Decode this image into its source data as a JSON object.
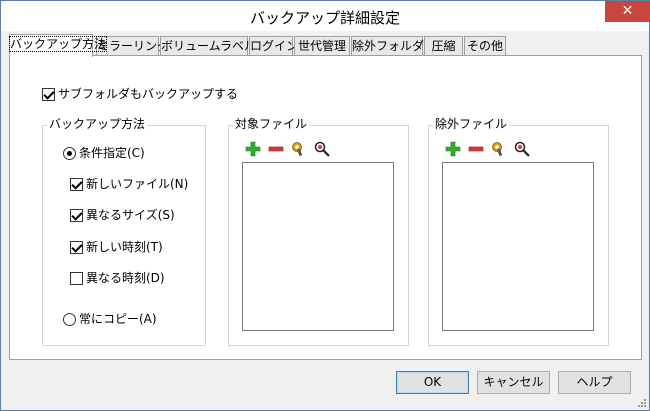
{
  "window": {
    "title": "バックアップ詳細設定",
    "close_glyph": "✕"
  },
  "tabs": [
    {
      "label": "バックアップ方法",
      "active": true
    },
    {
      "label": "ミラーリング"
    },
    {
      "label": "ボリュームラベル"
    },
    {
      "label": "ログイン"
    },
    {
      "label": "世代管理"
    },
    {
      "label": "除外フォルダ"
    },
    {
      "label": "圧縮"
    },
    {
      "label": "その他"
    }
  ],
  "subfolder_checkbox": {
    "label": "サブフォルダもバックアップする",
    "checked": true
  },
  "backup_method": {
    "title": "バックアップ方法",
    "conditional": {
      "label": "条件指定(C)",
      "selected": true
    },
    "conditions": [
      {
        "label": "新しいファイル(N)",
        "checked": true
      },
      {
        "label": "異なるサイズ(S)",
        "checked": true
      },
      {
        "label": "新しい時刻(T)",
        "checked": true
      },
      {
        "label": "異なる時刻(D)",
        "checked": false
      }
    ],
    "always_copy": {
      "label": "常にコピー(A)",
      "selected": false
    }
  },
  "target_files": {
    "title": "対象ファイル",
    "tools": [
      "add-icon",
      "remove-icon",
      "edit-icon",
      "search-icon"
    ]
  },
  "excluded_files": {
    "title": "除外ファイル",
    "tools": [
      "add-icon",
      "remove-icon",
      "edit-icon",
      "search-icon"
    ]
  },
  "buttons": {
    "ok": "OK",
    "cancel": "キャンセル",
    "help": "ヘルプ"
  },
  "colors": {
    "close": "#c7463d",
    "add": "#2fae2f",
    "remove": "#d8383a",
    "edit": "#d4a017",
    "accent": "#3c7fb1"
  }
}
